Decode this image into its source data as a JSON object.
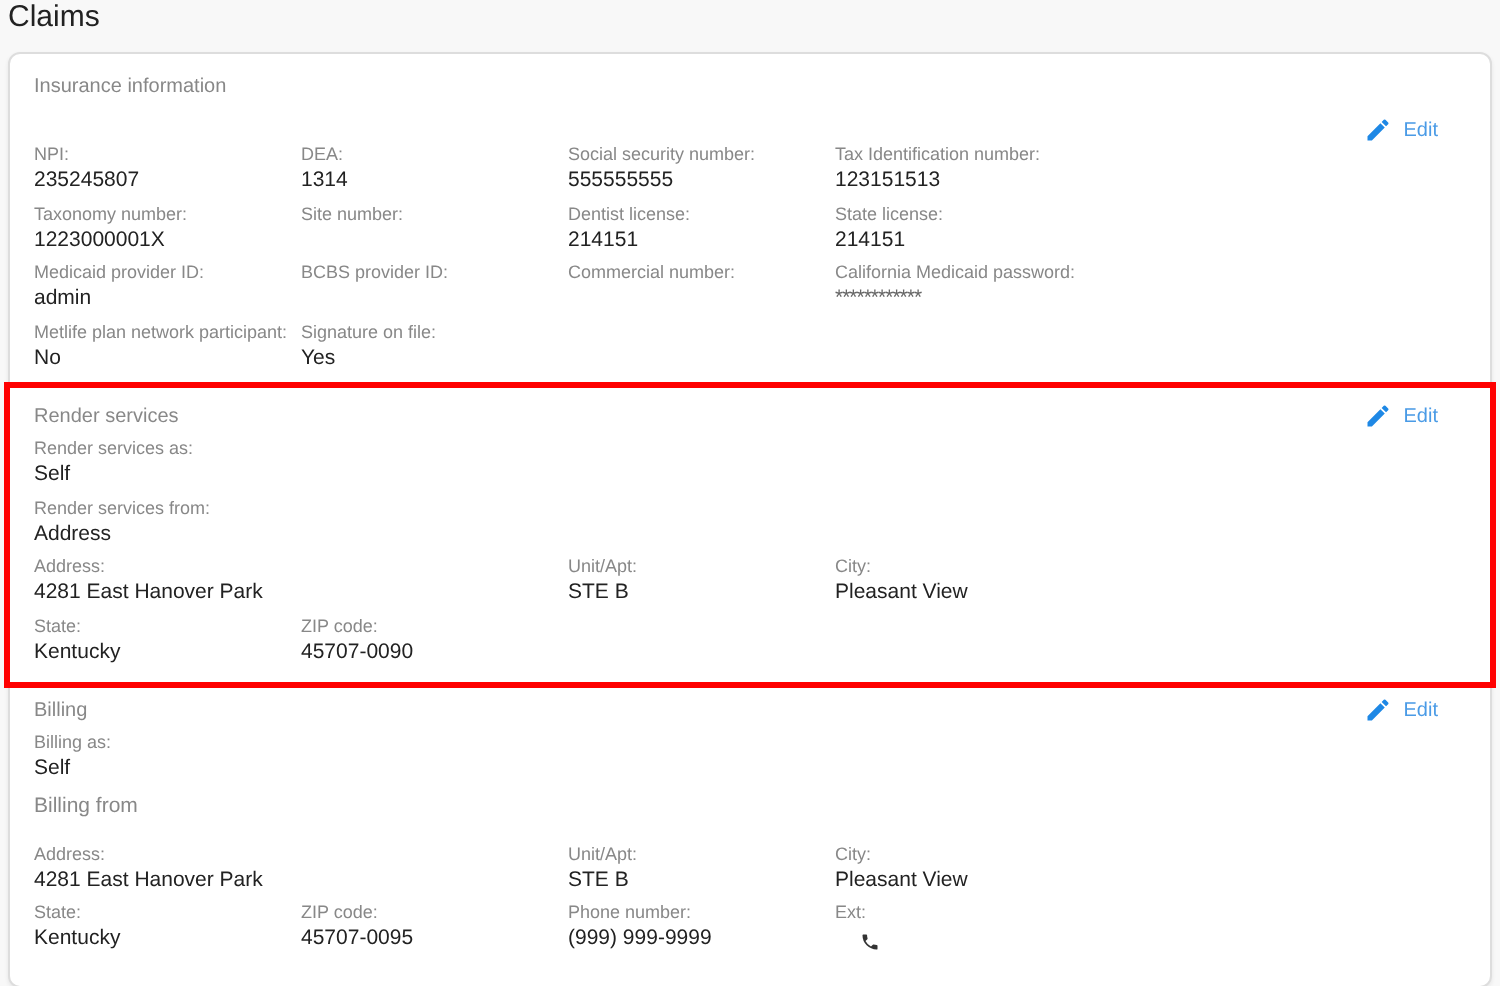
{
  "page": {
    "title": "Claims"
  },
  "sections": [
    {
      "title": "Insurance information",
      "highlighted": false,
      "edit": "Edit",
      "rows": [
        [
          {
            "label": "NPI:",
            "value": "235245807"
          },
          {
            "label": "DEA:",
            "value": "1314"
          },
          {
            "label": "Social security number:",
            "value": "555555555"
          },
          {
            "label": "Tax Identification number:",
            "value": "123151513"
          }
        ],
        [
          {
            "label": "Taxonomy number:",
            "value": "1223000001X"
          },
          {
            "label": "Site number:"
          },
          {
            "label": "Dentist license:",
            "value": "214151"
          },
          {
            "label": "State license:",
            "value": "214151"
          }
        ],
        [
          {
            "label": "Medicaid provider ID:",
            "value": "admin"
          },
          {
            "label": "BCBS provider ID:"
          },
          {
            "label": "Commercial number:"
          },
          {
            "label": "California Medicaid password:",
            "value": "************",
            "kind": "masked"
          }
        ],
        [
          {
            "label": "Metlife plan network participant:",
            "value": "No"
          },
          {
            "label": "Signature on file:",
            "value": "Yes"
          }
        ]
      ]
    },
    {
      "title": "Render services",
      "highlighted": true,
      "edit": "Edit",
      "rows": [
        [
          {
            "label": "Render services as:",
            "value": "Self"
          }
        ],
        [
          {
            "label": "Render services from:",
            "value": "Address"
          }
        ],
        [
          {
            "label": "Address:",
            "value": "4281 East Hanover Park",
            "kind": "wide"
          },
          {
            "label": "Unit/Apt:",
            "value": "STE B"
          },
          {
            "label": "City:",
            "value": "Pleasant View"
          }
        ],
        [
          {
            "label": "State:",
            "value": "Kentucky"
          },
          {
            "label": "ZIP code:",
            "value": "45707-0090"
          }
        ]
      ]
    },
    {
      "title": "Billing",
      "highlighted": false,
      "edit": "Edit",
      "rows": [
        [
          {
            "label": "Billing as:",
            "value": "Self"
          }
        ],
        {
          "subheading": "Billing from"
        },
        [
          {
            "label": "Address:",
            "value": "4281 East Hanover Park",
            "kind": "wide"
          },
          {
            "label": "Unit/Apt:",
            "value": "STE B"
          },
          {
            "label": "City:",
            "value": "Pleasant View"
          }
        ],
        [
          {
            "label": "State:",
            "value": "Kentucky"
          },
          {
            "label": "ZIP code:",
            "value": "45707-0095"
          },
          {
            "label": "Phone number:",
            "value": "(999) 999-9999"
          },
          {
            "label": "Ext:",
            "kind": "phone"
          }
        ]
      ]
    }
  ]
}
